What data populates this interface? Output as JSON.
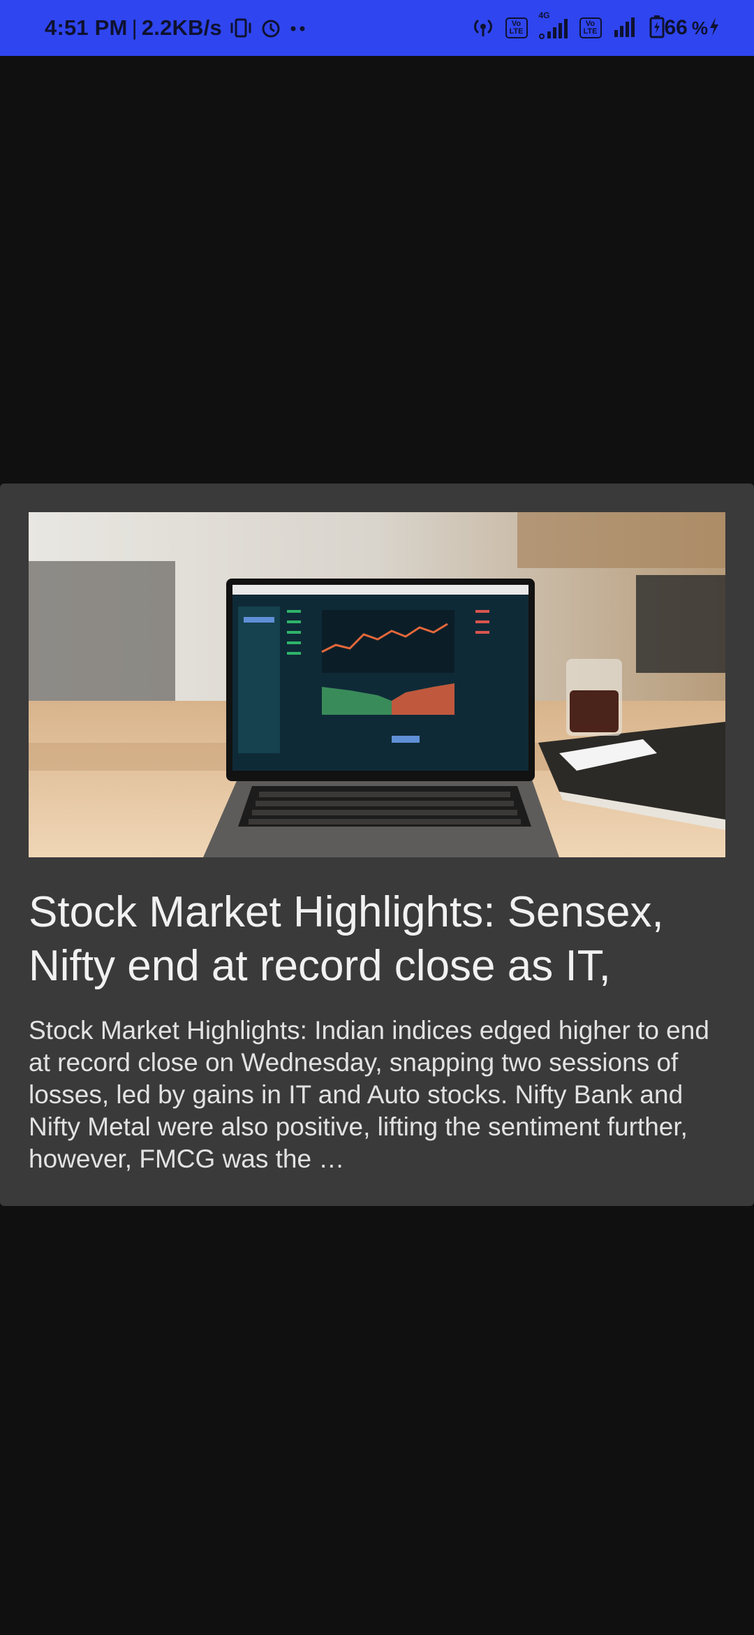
{
  "status_bar": {
    "time": "4:51 PM",
    "separator": "|",
    "network_speed": "2.2KB/s",
    "battery_level": "66",
    "network_type": "4G",
    "sim1_badge_top": "Vo",
    "sim1_badge_bottom": "LTE",
    "sim2_badge_top": "Vo",
    "sim2_badge_bottom": "LTE",
    "icons": [
      "vibrate-icon",
      "alarm-icon",
      "more-dots-icon",
      "hotspot-icon",
      "signal-icon",
      "battery-icon",
      "charging-icon"
    ],
    "bar_color": "#2F45EF"
  },
  "article": {
    "image_icon": "laptop-stock-chart-image",
    "headline": "Stock Market Highlights: Sensex, Nifty end at record close as IT,",
    "summary": "Stock Market Highlights: Indian indices edged higher to end at record close on Wednesday, snapping two sessions of losses, led by gains in IT and Auto stocks. Nifty Bank and Nifty Metal were also positive, lifting the sentiment further, however, FMCG was the …",
    "card_color": "#3A3A3A"
  }
}
